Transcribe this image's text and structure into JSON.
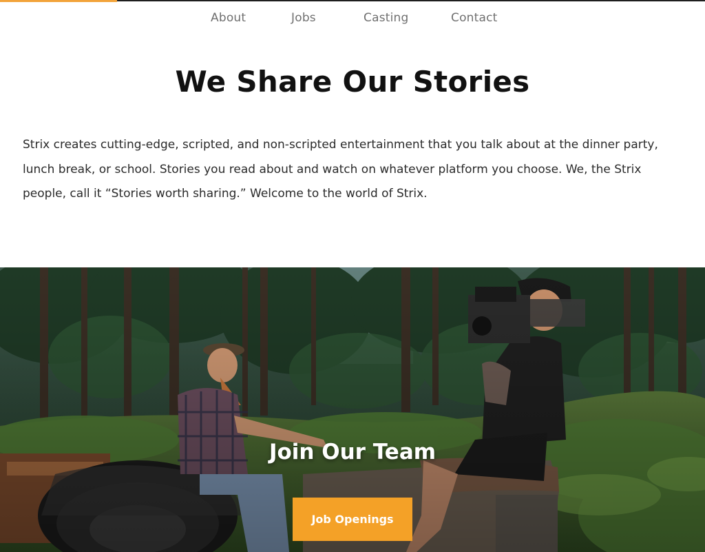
{
  "nav": {
    "items": [
      {
        "label": "About"
      },
      {
        "label": "Jobs"
      },
      {
        "label": "Casting"
      },
      {
        "label": "Contact"
      }
    ]
  },
  "hero": {
    "title": "We Share Our Stories",
    "body": "Strix creates cutting-edge, scripted, and non-scripted entertainment that you talk about at the dinner party, lunch break, or school. Stories you read about and watch on whatever platform you choose. We, the Strix people, call it “Stories worth sharing.” Welcome to the world of Strix."
  },
  "team": {
    "heading": "Join Our Team",
    "button_label": "Job Openings"
  },
  "colors": {
    "accent": "#f4a127",
    "nav_text": "#6f6f6f",
    "heading": "#111111"
  }
}
